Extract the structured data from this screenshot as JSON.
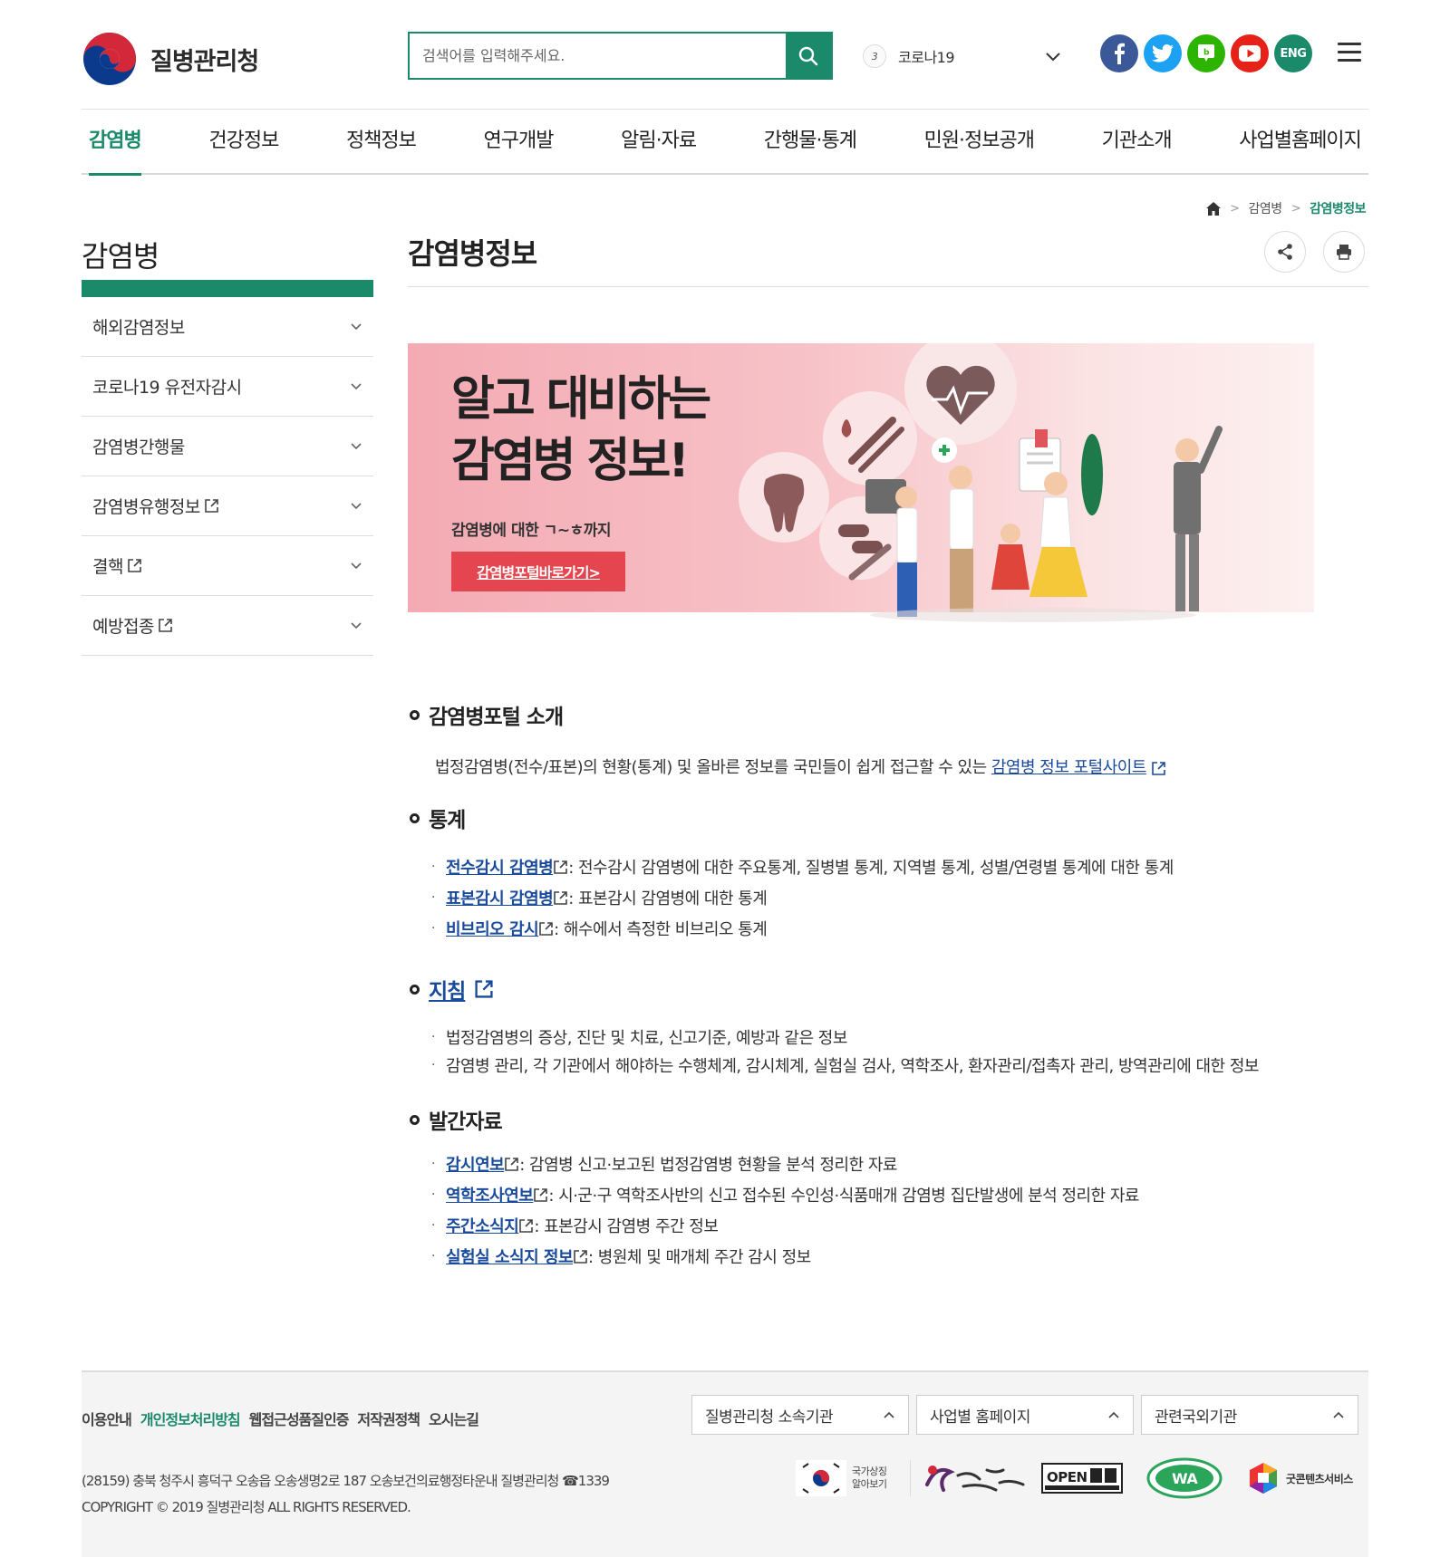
{
  "header": {
    "org_name": "질병관리청",
    "search_placeholder": "검색어를 입력해주세요.",
    "rank_number": "3",
    "rank_keyword": "코로나19",
    "eng_label": "ENG",
    "social": [
      "facebook-icon",
      "twitter-icon",
      "blog-icon",
      "youtube-icon"
    ]
  },
  "gnb": [
    "감염병",
    "건강정보",
    "정책정보",
    "연구개발",
    "알림·자료",
    "간행물·통계",
    "민원·정보공개",
    "기관소개",
    "사업별홈페이지"
  ],
  "breadcrumb": {
    "level1": "감염병",
    "current": "감염병정보"
  },
  "sidebar": {
    "title": "감염병",
    "items": [
      {
        "label": "해외감염정보",
        "external": false
      },
      {
        "label": "코로나19 유전자감시",
        "external": false
      },
      {
        "label": "감염병간행물",
        "external": false
      },
      {
        "label": "감염병유행정보",
        "external": true
      },
      {
        "label": "결핵",
        "external": true
      },
      {
        "label": "예방접종",
        "external": true
      }
    ]
  },
  "content": {
    "title": "감염병정보",
    "banner": {
      "line1": "알고 대비하는",
      "line2": "감염병 정보!",
      "sub": "감염병에 대한 ㄱ~ㅎ까지",
      "button": "감염병포털바로가기>"
    },
    "sections": {
      "portal": {
        "heading": "감염병포털 소개",
        "text": "법정감염병(전수/표본)의 현황(통계) 및 올바른 정보를 국민들이 쉽게 접근할 수 있는",
        "link": "감염병 정보 포털사이트"
      },
      "stats": {
        "heading": "통계",
        "items": [
          {
            "link": "전수감시 감염병",
            "text": ": 전수감시 감염병에 대한 주요통계, 질병별 통계, 지역별 통계, 성별/연령별 통계에 대한 통계"
          },
          {
            "link": "표본감시 감염병",
            "text": ": 표본감시 감염병에 대한 통계"
          },
          {
            "link": "비브리오 감시",
            "text": ": 해수에서 측정한 비브리오 통계"
          }
        ]
      },
      "guide": {
        "heading": "지침",
        "items": [
          "법정감염병의 증상, 진단 및 치료, 신고기준, 예방과 같은 정보",
          "감염병 관리, 각 기관에서 해야하는 수행체계, 감시체계, 실험실 검사, 역학조사, 환자관리/접촉자 관리, 방역관리에 대한 정보"
        ]
      },
      "pubs": {
        "heading": "발간자료",
        "items": [
          {
            "link": "감시연보",
            "text": ": 감염병 신고·보고된 법정감염병 현황을 분석 정리한 자료"
          },
          {
            "link": "역학조사연보",
            "text": ": 시·군·구 역학조사반의 신고 접수된 수인성·식품매개 감염병 집단발생에 분석 정리한 자료"
          },
          {
            "link": "주간소식지",
            "text": ": 표본감시 감염병 주간 정보"
          },
          {
            "link": "실험실 소식지 정보",
            "text": ": 병원체 및 매개체 주간 감시 정보"
          }
        ]
      }
    }
  },
  "footer": {
    "links": [
      "이용안내",
      "개인정보처리방침",
      "웹접근성품질인증",
      "저작권정책",
      "오시는길"
    ],
    "selects": [
      "질병관리청 소속기관",
      "사업별 홈페이지",
      "관련국외기관"
    ],
    "address": "(28159) 충북 청주시 흥덕구 오송읍 오송생명2로 187 오송보건의료행정타운내 질병관리청 ☎1339",
    "copyright": "COPYRIGHT © 2019 질병관리청 ALL RIGHTS RESERVED.",
    "badges": {
      "national_symbol": "국가상징 알아보기",
      "open": "OPEN",
      "wa": "WA",
      "goodcontent": "굿콘텐츠서비스"
    }
  },
  "colors": {
    "brand_green": "#1a8a6a",
    "link_blue": "#1a4a9c",
    "banner_red": "#e5454e"
  }
}
